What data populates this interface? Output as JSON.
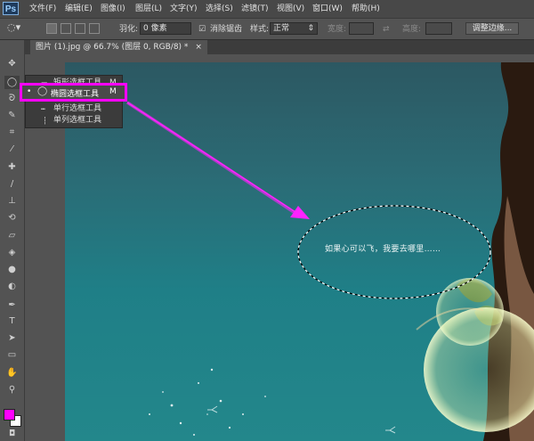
{
  "menubar": {
    "logo": "Ps",
    "items": [
      "文件(F)",
      "编辑(E)",
      "图像(I)",
      "图层(L)",
      "文字(Y)",
      "选择(S)",
      "滤镜(T)",
      "视图(V)",
      "窗口(W)",
      "帮助(H)"
    ]
  },
  "options": {
    "feather_label": "羽化:",
    "feather_value": "0 像素",
    "antialias_label": "消除锯齿",
    "style_label": "样式:",
    "style_value": "正常",
    "width_label": "宽度:",
    "height_label": "高度:",
    "refine_button": "调整边缘..."
  },
  "document": {
    "tab_title": "图片 (1).jpg @ 66.7% (图层 0, RGB/8) *",
    "close": "×"
  },
  "flyout": {
    "items": [
      {
        "marker": "",
        "label": "矩形选框工具",
        "shortcut": "M"
      },
      {
        "marker": "•",
        "label": "椭圆选框工具",
        "shortcut": "M"
      },
      {
        "marker": "",
        "label": "单行选框工具",
        "shortcut": ""
      },
      {
        "marker": "",
        "label": "单列选框工具",
        "shortcut": ""
      }
    ]
  },
  "canvas": {
    "caption": "如果心可以飞，我要去哪里……"
  },
  "colors": {
    "foreground": "#ff00ff",
    "background": "#ffffff",
    "annotation": "#ff00ff"
  }
}
